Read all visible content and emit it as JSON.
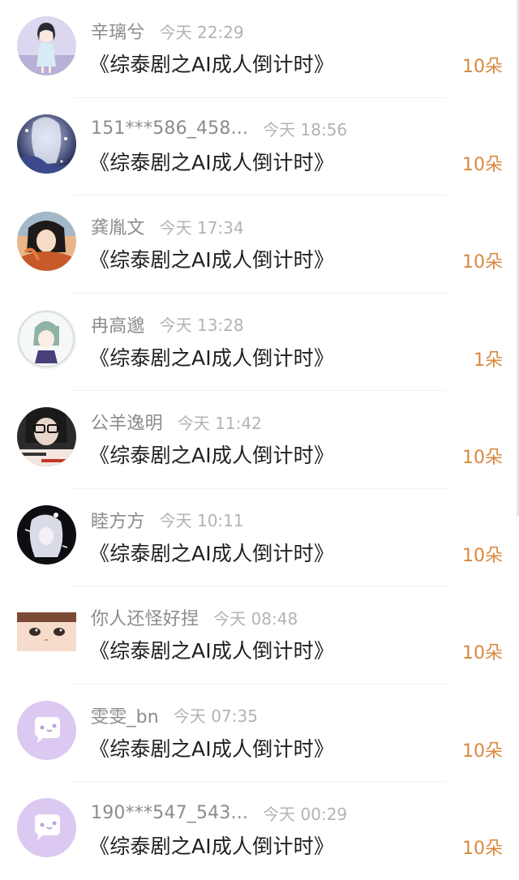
{
  "accent_color": "#d9883d",
  "items": [
    {
      "name": "辛璃兮",
      "time": "今天 22:29",
      "title": "《综泰剧之AI成人倒计时》",
      "amount": "10朵",
      "avatar_icon": "girl-avatar-icon"
    },
    {
      "name": "151***586_458...",
      "time": "今天 18:56",
      "title": "《综泰剧之AI成人倒计时》",
      "amount": "10朵",
      "avatar_icon": "anime-night-avatar-icon"
    },
    {
      "name": "龚胤文",
      "time": "今天 17:34",
      "title": "《综泰剧之AI成人倒计时》",
      "amount": "10朵",
      "avatar_icon": "anime-warrior-avatar-icon"
    },
    {
      "name": "冉高邈",
      "time": "今天 13:28",
      "title": "《综泰剧之AI成人倒计时》",
      "amount": "1朵",
      "avatar_icon": "chibi-avatar-icon"
    },
    {
      "name": "公羊逸明",
      "time": "今天 11:42",
      "title": "《综泰剧之AI成人倒计时》",
      "amount": "10朵",
      "avatar_icon": "glasses-girl-avatar-icon"
    },
    {
      "name": "睦方方",
      "time": "今天 10:11",
      "title": "《综泰剧之AI成人倒计时》",
      "amount": "10朵",
      "avatar_icon": "dark-anime-avatar-icon"
    },
    {
      "name": "你人还怪好捏",
      "time": "今天 08:48",
      "title": "《综泰剧之AI成人倒计时》",
      "amount": "10朵",
      "avatar_icon": "boy-eyes-avatar-icon"
    },
    {
      "name": "雯雯_bn",
      "time": "今天 07:35",
      "title": "《综泰剧之AI成人倒计时》",
      "amount": "10朵",
      "avatar_icon": "default-chat-avatar-icon"
    },
    {
      "name": "190***547_543...",
      "time": "今天 00:29",
      "title": "《综泰剧之AI成人倒计时》",
      "amount": "10朵",
      "avatar_icon": "default-chat-avatar-icon"
    }
  ]
}
